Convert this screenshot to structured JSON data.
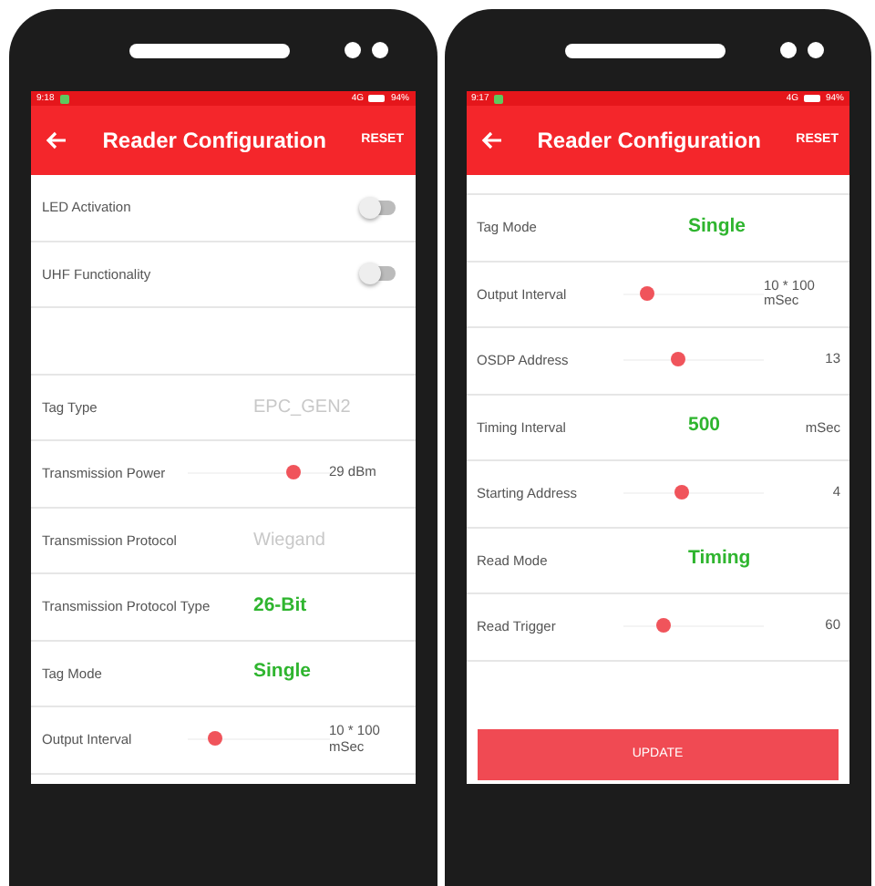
{
  "phones": [
    {
      "status_bar": {
        "time": "9:18",
        "network": "4G",
        "battery": "94%"
      },
      "app_bar": {
        "title": "Reader Configuration",
        "action": "RESET"
      },
      "top_cut": false,
      "rows": [
        {
          "kind": "toggle",
          "label": "LED Activation",
          "on": false
        },
        {
          "kind": "toggle",
          "label": "UHF Functionality",
          "on": false
        },
        {
          "kind": "blank"
        },
        {
          "kind": "picker",
          "label": "Tag Type",
          "value": "EPC_GEN2"
        },
        {
          "kind": "slider",
          "label": "Transmission Power",
          "level": 0.77,
          "value": "29 dBm"
        },
        {
          "kind": "picker",
          "label": "Transmission Protocol",
          "value": "Wiegand"
        },
        {
          "kind": "choice",
          "label": "Transmission Protocol Type",
          "value": "26-Bit"
        },
        {
          "kind": "choice",
          "label": "Tag Mode",
          "value": "Single"
        },
        {
          "kind": "slider",
          "label": "Output Interval",
          "level": 0.16,
          "value": "10 * 100 mSec"
        }
      ]
    },
    {
      "status_bar": {
        "time": "9:17",
        "network": "4G",
        "battery": "94%"
      },
      "app_bar": {
        "title": "Reader Configuration",
        "action": "RESET"
      },
      "top_cut": true,
      "rows": [
        {
          "kind": "choice",
          "label": "Tag Mode",
          "value": "Single"
        },
        {
          "kind": "slider",
          "label": "Output Interval",
          "level": 0.14,
          "value": "10 * 100 mSec"
        },
        {
          "kind": "slider",
          "label": "OSDP Address",
          "level": 0.38,
          "value": "13"
        },
        {
          "kind": "number",
          "label": "Timing Interval",
          "value": "500",
          "unit": "mSec"
        },
        {
          "kind": "slider",
          "label": "Starting Address",
          "level": 0.41,
          "value": "4"
        },
        {
          "kind": "choice",
          "label": "Read Mode",
          "value": "Timing"
        },
        {
          "kind": "slider",
          "label": "Read Trigger",
          "level": 0.26,
          "value": "60"
        }
      ],
      "button": {
        "label": "UPDATE",
        "disabled": true
      }
    }
  ]
}
